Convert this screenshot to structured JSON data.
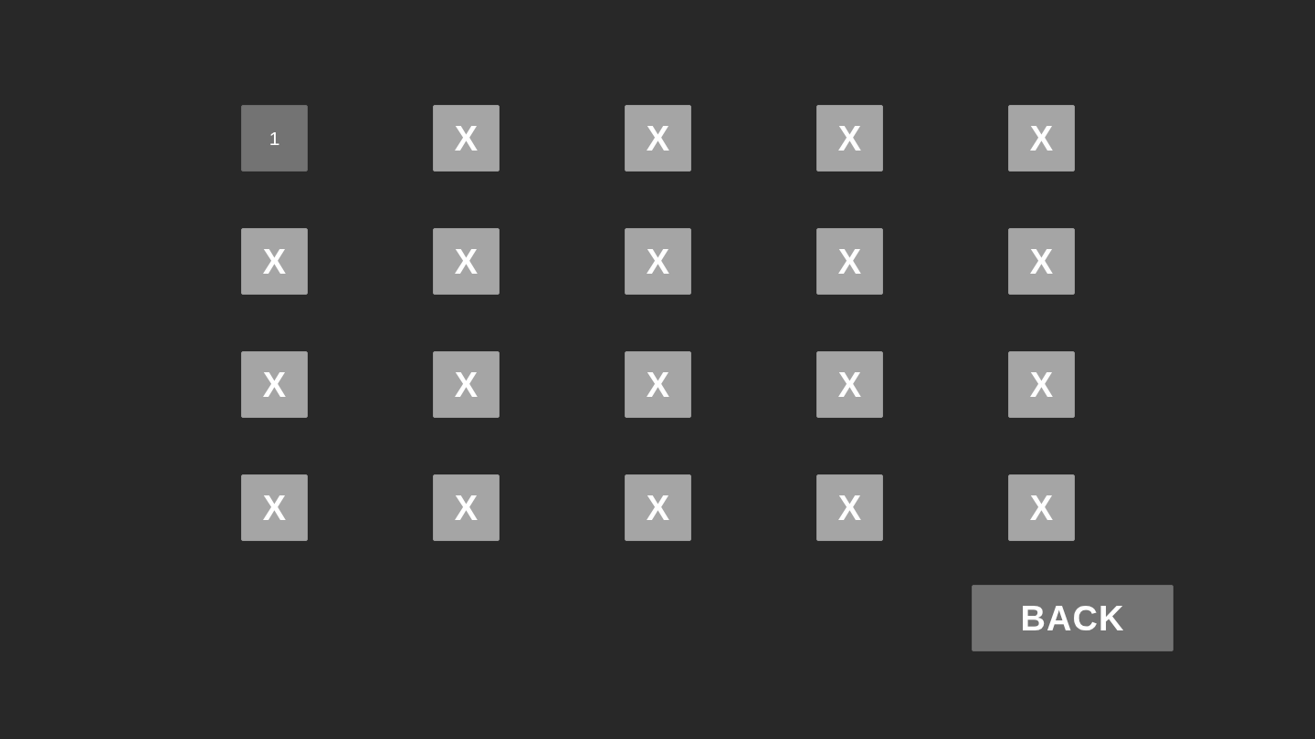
{
  "levels": [
    {
      "label": "1",
      "locked": false
    },
    {
      "label": "X",
      "locked": true
    },
    {
      "label": "X",
      "locked": true
    },
    {
      "label": "X",
      "locked": true
    },
    {
      "label": "X",
      "locked": true
    },
    {
      "label": "X",
      "locked": true
    },
    {
      "label": "X",
      "locked": true
    },
    {
      "label": "X",
      "locked": true
    },
    {
      "label": "X",
      "locked": true
    },
    {
      "label": "X",
      "locked": true
    },
    {
      "label": "X",
      "locked": true
    },
    {
      "label": "X",
      "locked": true
    },
    {
      "label": "X",
      "locked": true
    },
    {
      "label": "X",
      "locked": true
    },
    {
      "label": "X",
      "locked": true
    },
    {
      "label": "X",
      "locked": true
    },
    {
      "label": "X",
      "locked": true
    },
    {
      "label": "X",
      "locked": true
    },
    {
      "label": "X",
      "locked": true
    },
    {
      "label": "X",
      "locked": true
    }
  ],
  "back_button": {
    "label": "BACK"
  }
}
